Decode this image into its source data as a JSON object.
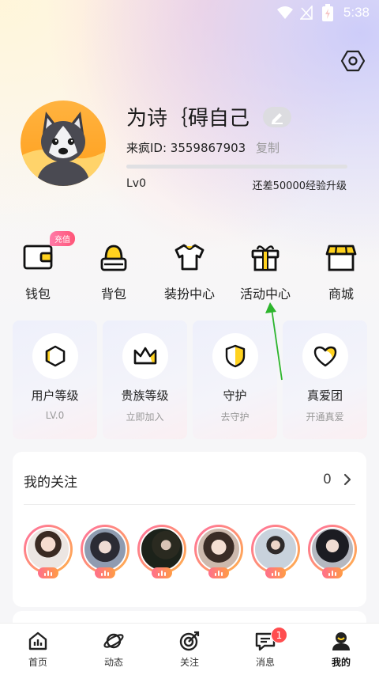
{
  "status_bar": {
    "time": "5:38"
  },
  "profile": {
    "nickname": "为诗｛碍自己",
    "id_label": "来疯ID: 3559867903",
    "copy_label": "复制",
    "level": "Lv0",
    "exp_hint": "还差50000经验升级",
    "exp_progress": 0
  },
  "functions": {
    "recharge_badge": "充值",
    "items": [
      {
        "label": "钱包"
      },
      {
        "label": "背包"
      },
      {
        "label": "装扮中心"
      },
      {
        "label": "活动中心"
      },
      {
        "label": "商城"
      }
    ]
  },
  "cards": [
    {
      "title": "用户等级",
      "sub": "LV.0"
    },
    {
      "title": "贵族等级",
      "sub": "立即加入"
    },
    {
      "title": "守护",
      "sub": "去守护"
    },
    {
      "title": "真爱团",
      "sub": "开通真爱"
    }
  ],
  "following": {
    "title": "我的关注",
    "count": "0"
  },
  "bottom_nav": {
    "items": [
      {
        "label": "首页"
      },
      {
        "label": "动态"
      },
      {
        "label": "关注"
      },
      {
        "label": "消息"
      },
      {
        "label": "我的"
      }
    ],
    "message_badge": "1"
  },
  "colors": {
    "accent": "#f5b400",
    "live_badge": "#ff6f8c",
    "annotation": "#2db52d"
  }
}
